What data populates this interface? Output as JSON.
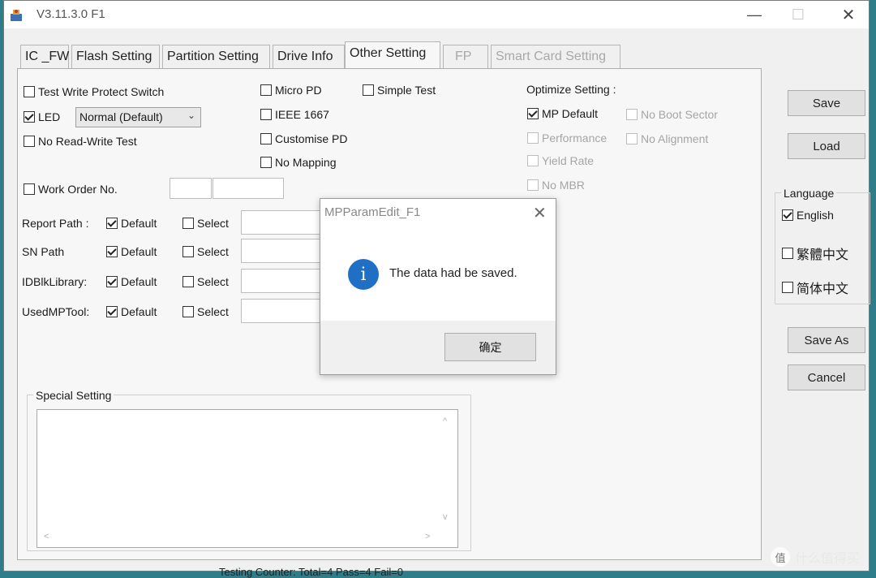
{
  "window": {
    "title": "V3.11.3.0 F1",
    "minimize": "—",
    "maximize": "☐",
    "close": "✕"
  },
  "tabs": [
    {
      "label": "IC _FW"
    },
    {
      "label": "Flash Setting"
    },
    {
      "label": "Partition Setting"
    },
    {
      "label": "Drive Info"
    },
    {
      "label": "Other Setting",
      "active": true
    },
    {
      "label": "FP",
      "disabled": true
    },
    {
      "label": "Smart Card Setting",
      "disabled": true
    }
  ],
  "other": {
    "test_write_protect": {
      "label": "Test Write Protect Switch",
      "checked": false
    },
    "led": {
      "label": "LED",
      "checked": true,
      "mode": "Normal (Default)"
    },
    "no_rw_test": {
      "label": "No Read-Write Test",
      "checked": false
    },
    "micro_pd": {
      "label": "Micro PD",
      "checked": false
    },
    "ieee_1667": {
      "label": "IEEE 1667",
      "checked": false
    },
    "customise_pd": {
      "label": "Customise PD",
      "checked": false
    },
    "no_mapping": {
      "label": "No Mapping",
      "checked": false
    },
    "simple_test": {
      "label": "Simple Test",
      "checked": false
    },
    "work_order": {
      "label": "Work Order No.",
      "checked": false
    }
  },
  "optimize": {
    "title": "Optimize Setting :",
    "mp_default": {
      "label": "MP Default",
      "checked": true
    },
    "performance": {
      "label": "Performance"
    },
    "yield_rate": {
      "label": "Yield Rate"
    },
    "no_mbr": {
      "label": "No MBR"
    },
    "no_boot_sector": {
      "label": "No Boot Sector"
    },
    "no_alignment": {
      "label": "No Alignment"
    }
  },
  "paths": [
    {
      "label": "Report Path :",
      "default": "Default",
      "select": "Select"
    },
    {
      "label": "SN Path",
      "default": "Default",
      "select": "Select"
    },
    {
      "label": "IDBlkLibrary:",
      "default": "Default",
      "select": "Select"
    },
    {
      "label": "UsedMPTool:",
      "default": "Default",
      "select": "Select"
    }
  ],
  "special": {
    "label": "Special Setting",
    "up": "^",
    "down": "v",
    "left": "<",
    "right": ">"
  },
  "side": {
    "save": "Save",
    "load": "Load",
    "save_as": "Save As",
    "cancel": "Cancel"
  },
  "language": {
    "title": "Language",
    "english": "English",
    "traditional": "繁體中文",
    "simplified": "简体中文"
  },
  "dialog": {
    "title": "MPParamEdit_F1",
    "close": "✕",
    "info": "i",
    "message": "The data had be saved.",
    "ok": "确定"
  },
  "background": {
    "status_text": "Testing Counter: Total=4    Pass=4    Fail=0"
  },
  "watermark": {
    "logo": "值",
    "text": "什么值得买"
  }
}
